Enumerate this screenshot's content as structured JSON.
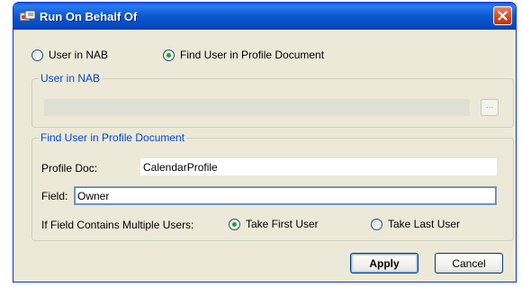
{
  "window": {
    "title": "Run On Behalf Of",
    "close_label": "✕"
  },
  "mode": {
    "options": [
      {
        "label": "User in NAB",
        "selected": false
      },
      {
        "label": "Find User in Profile Document",
        "selected": true
      }
    ]
  },
  "nab_group": {
    "legend": "User in NAB",
    "value": "",
    "browse_label": "..."
  },
  "profile_group": {
    "legend": "Find User in Profile Document",
    "profile_doc_label": "Profile Doc:",
    "profile_doc_value": "CalendarProfile",
    "field_label": "Field:",
    "field_value": "Owner",
    "multi_label": "If Field Contains Multiple Users:",
    "multi_options": [
      {
        "label": "Take First User",
        "selected": true
      },
      {
        "label": "Take Last User",
        "selected": false
      }
    ]
  },
  "buttons": {
    "apply": "Apply",
    "cancel": "Cancel"
  }
}
